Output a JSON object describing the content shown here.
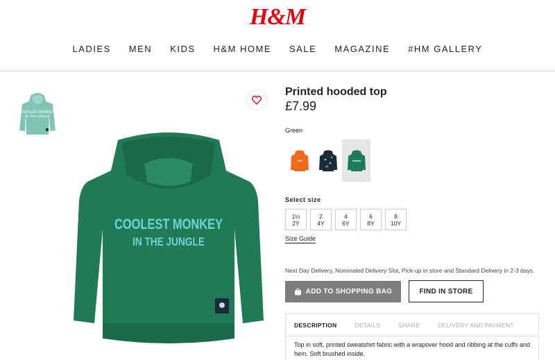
{
  "brand": {
    "logo_text": "H&M",
    "color": "#e50010"
  },
  "nav": [
    "LADIES",
    "MEN",
    "KIDS",
    "H&M HOME",
    "SALE",
    "MAGAZINE",
    "#HM GALLERY"
  ],
  "product": {
    "title": "Printed hooded top",
    "price": "£7.99",
    "color_name": "Green",
    "print_line1": "COOLEST MONKEY",
    "print_line2": "IN THE JUNGLE",
    "swatch_colors": [
      "#f26b1d",
      "#1c2a3a",
      "#1f7a58"
    ],
    "selected_swatch": 2
  },
  "size_section": {
    "label": "Select size",
    "sizes": [
      {
        "top": "1½",
        "bottom": "2Y"
      },
      {
        "top": "2",
        "bottom": "4Y"
      },
      {
        "top": "4",
        "bottom": "6Y"
      },
      {
        "top": "6",
        "bottom": "8Y"
      },
      {
        "top": "8",
        "bottom": "10Y"
      }
    ],
    "guide_label": "Size Guide"
  },
  "delivery_text": "Next Day Delivery, Nominated Delivery Slot, Pick-up in store and Standard Delivery in 2-3 days.",
  "buttons": {
    "add_to_bag": "ADD TO SHOPPING BAG",
    "find_in_store": "FIND IN STORE"
  },
  "tabs": [
    "DESCRIPTION",
    "DETAILS",
    "SHARE",
    "DELIVERY AND PAYMENT"
  ],
  "description": "Top in soft, printed sweatshirt fabric with a wrapover hood and ribbing at the cuffs and hem. Soft brushed inside."
}
